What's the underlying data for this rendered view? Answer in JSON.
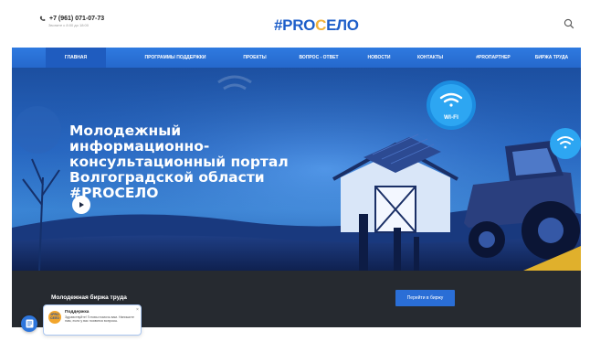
{
  "header": {
    "phone": "+7 (961) 071-07-73",
    "phone_note": "Звоните с 8:00 до 18:00",
    "logo_main": "#PRO",
    "logo_accent": "С",
    "logo_rest": "ЕЛО"
  },
  "nav": {
    "items": [
      {
        "label": "Главная",
        "active": true
      },
      {
        "label": "Программы поддержки",
        "active": false
      },
      {
        "label": "Проекты",
        "active": false
      },
      {
        "label": "Вопрос - ответ",
        "active": false
      },
      {
        "label": "Новости",
        "active": false
      },
      {
        "label": "Контакты",
        "active": false
      },
      {
        "label": "#PROпартнер",
        "active": false
      },
      {
        "label": "Биржа труда",
        "active": false
      }
    ]
  },
  "hero": {
    "title": "Молодежный информационно-консультационный портал Волгоградской области #PROСЕЛО",
    "wifi_badge": "WI-FI"
  },
  "band": {
    "title": "Молодежная биржа труда",
    "button": "Перейти в биржу"
  },
  "chat": {
    "avatar_text": "#PRO СЕЛО",
    "name": "Поддержка",
    "message": "Здравствуйте! Готовы помочь вам. Напишите нам, если у вас появятся вопросы.",
    "close": "×"
  },
  "colors": {
    "brand_blue": "#2f7ae0",
    "brand_orange": "#f2b23a",
    "dark_band": "#262a30"
  }
}
